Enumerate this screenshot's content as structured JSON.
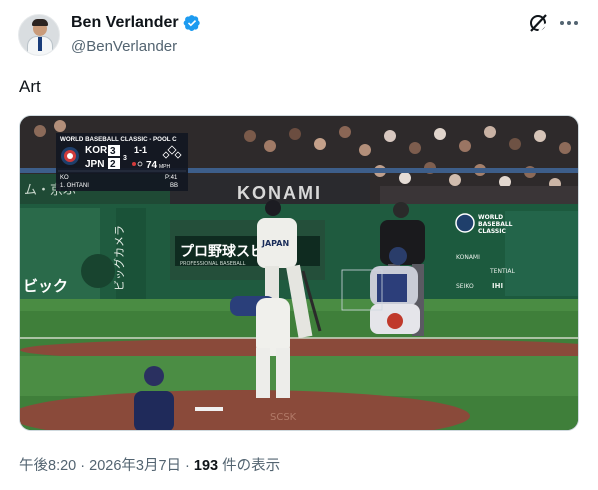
{
  "author": {
    "display_name": "Ben Verlander",
    "handle": "@BenVerlander"
  },
  "tweet": {
    "text": "Art"
  },
  "media": {
    "scorebug": {
      "title": "WORLD BASEBALL CLASSIC - POOL C",
      "team_top": "KOR",
      "team_top_score": "3",
      "team_bottom": "JPN",
      "team_bottom_score": "2",
      "inning": "3",
      "count": "1-1",
      "pitch_speed": "74",
      "speed_unit": "MPH",
      "pitcher": "KO",
      "pitch_count": "P:41",
      "batter": "1. OHTANI",
      "batter_stat": "BB"
    },
    "banner_konami": "KONAMI",
    "board_left_text": "プロ野球スピ",
    "board_left_sub": "PROFESSIONAL BASEBALL",
    "wbc_logo_text": "WORLD BASEBALL CLASSIC",
    "sponsors": [
      "KONAMI",
      "TENTIAL",
      "SEIKO",
      "IHI"
    ],
    "jersey_text": "JAPAN",
    "mound_text": "SCSK",
    "left_sign": "ビック"
  },
  "meta": {
    "time": "午後8:20",
    "sep1": " · ",
    "date": "2026年3月7日",
    "sep2": " · ",
    "views": "193",
    "views_label": " 件の表示"
  },
  "colors": {
    "verified": "#1d9bf0",
    "field": "#3f7f3a",
    "dirt": "#8a4a3a",
    "wall": "#1f5b3f"
  }
}
